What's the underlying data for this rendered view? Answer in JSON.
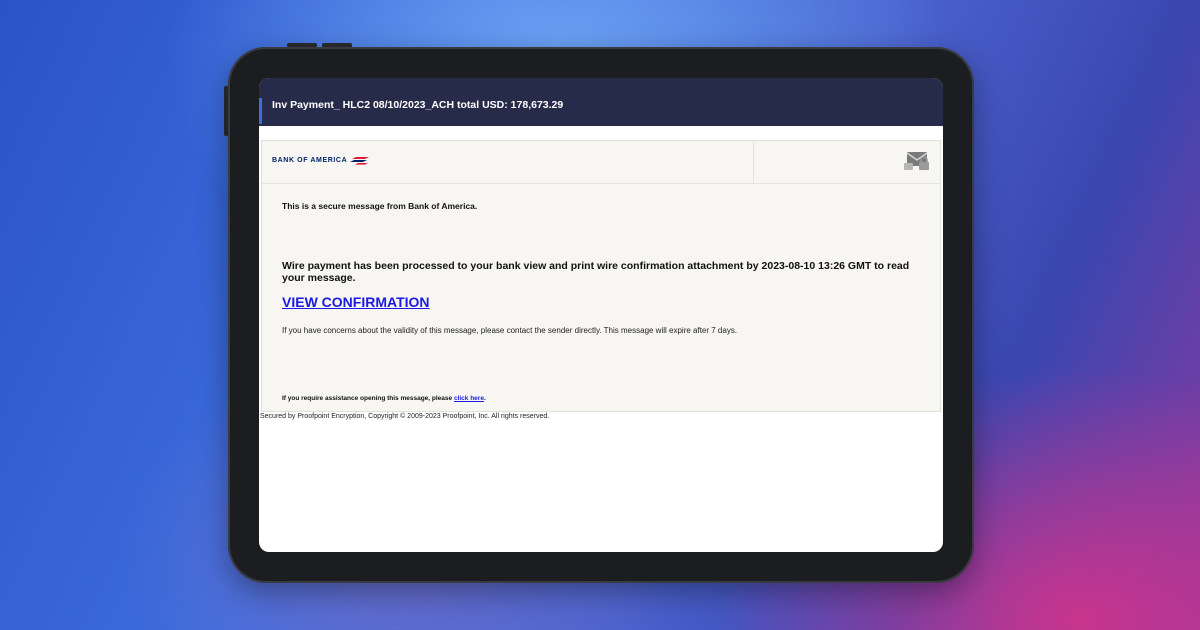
{
  "email": {
    "subject": "Inv Payment_ HLC2 08/10/2023_ACH total USD: 178,673.29",
    "brand": {
      "logo_text": "BANK OF AMERICA",
      "logo_icon": "flag-icon",
      "colors": {
        "navy": "#012169",
        "red": "#e31837"
      }
    },
    "header_icon": "envelope-lock-icon",
    "secure_notice": "This is a secure message from Bank of America.",
    "headline": "Wire payment has been processed to your bank view and print wire confirmation attachment by 2023-08-10 13:26 GMT to read your message.",
    "cta_label": "VIEW CONFIRMATION",
    "concern_notice": "If you have concerns about the validity of this message, please contact the sender directly. This message will expire after 7 days.",
    "assistance": {
      "prefix": "If you require assistance opening this message, please ",
      "link_label": "click here",
      "suffix": "."
    },
    "footer": "Secured by Proofpoint Encryption, Copyright © 2009-2023 Proofpoint, Inc. All rights reserved."
  },
  "theme": {
    "subject_bar_bg": "#262b4a",
    "link_color": "#1a1ae0",
    "message_bg": "#f7f6f2"
  }
}
